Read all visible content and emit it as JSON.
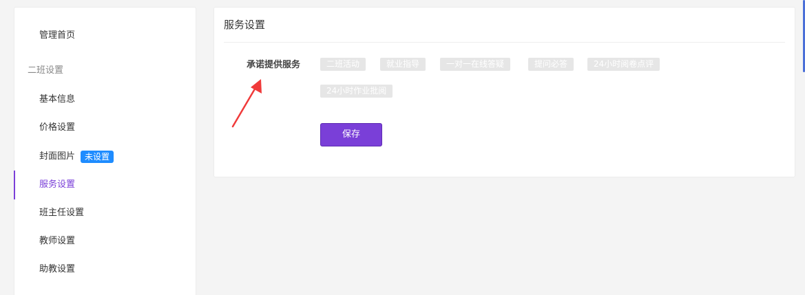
{
  "sidebar": {
    "home": "管理首页",
    "group_title": "二班设置",
    "items": [
      {
        "label": "基本信息"
      },
      {
        "label": "价格设置"
      },
      {
        "label": "封面图片",
        "badge": "未设置"
      },
      {
        "label": "服务设置"
      },
      {
        "label": "班主任设置"
      },
      {
        "label": "教师设置"
      },
      {
        "label": "助教设置"
      }
    ],
    "active_item": "服务设置"
  },
  "panel": {
    "title": "服务设置",
    "field_label": "承诺提供服务",
    "services": [
      "二班活动",
      "就业指导",
      "一对一在线答疑",
      "提问必答",
      "24小时阅卷点评",
      "24小时作业批阅"
    ],
    "save_label": "保存"
  },
  "colors": {
    "accent": "#7a3fd8",
    "badge": "#1e8cff",
    "tag_bg": "#e6e6e6",
    "annotation_arrow": "#f03a3a"
  }
}
